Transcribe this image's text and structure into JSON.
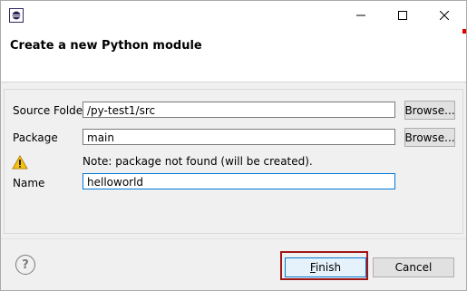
{
  "window": {
    "title": "",
    "controls": {
      "minimize": "—",
      "maximize": "☐",
      "close": "✕"
    }
  },
  "header": {
    "title": "Create a new Python module"
  },
  "form": {
    "source_folder": {
      "label": "Source Folder",
      "value": "/py-test1/src",
      "button": "Browse..."
    },
    "package": {
      "label": "Package",
      "value": "main",
      "button": "Browse..."
    },
    "warning": {
      "icon": "warning-icon",
      "text": "Note: package not found (will be created)."
    },
    "name": {
      "label": "Name",
      "value": "helloworld"
    }
  },
  "footer": {
    "help_icon": "question-icon",
    "help_glyph": "?",
    "finish_label": "Finish",
    "cancel_label": "Cancel"
  },
  "colors": {
    "highlight_border": "#a01616",
    "focus": "#0078d7",
    "warning": "#f5c211"
  }
}
